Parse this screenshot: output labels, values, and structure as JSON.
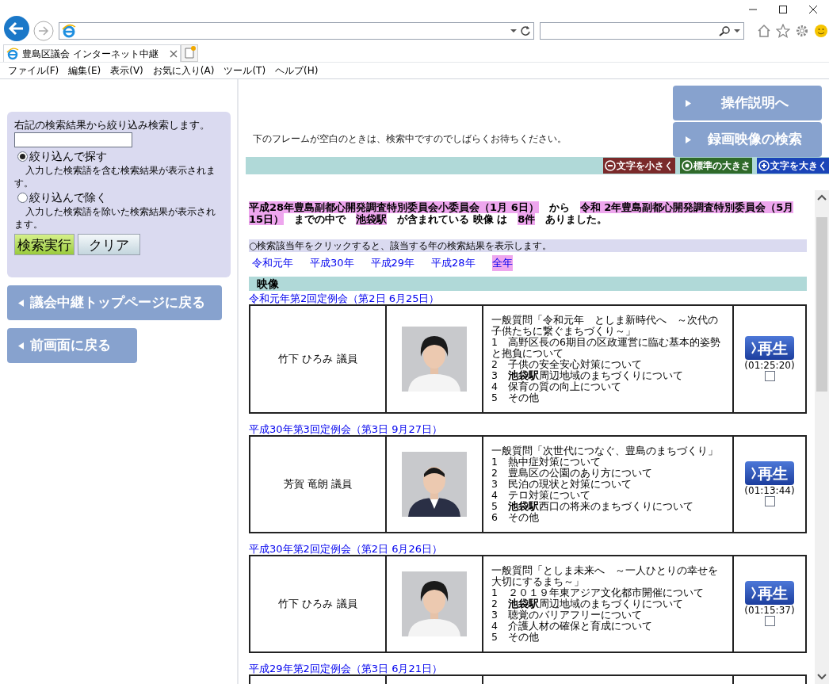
{
  "browser": {
    "tab_title": "豊島区議会 インターネット中継",
    "menu": [
      "ファイル(F)",
      "編集(E)",
      "表示(V)",
      "お気に入り(A)",
      "ツール(T)",
      "ヘルプ(H)"
    ]
  },
  "filter_panel": {
    "intro": "右記の検索結果から絞り込み検索します。",
    "options": [
      {
        "label": "絞り込んで探す",
        "selected": true,
        "note": "入力した検索語を含む検索結果が表示されます。"
      },
      {
        "label": "絞り込んで除く",
        "selected": false,
        "note": "入力した検索語を除いた検索結果が表示されます。"
      }
    ],
    "search_button": "検索実行",
    "clear_button": "クリア"
  },
  "nav_buttons": [
    "議会中継トップページに戻る",
    "前画面に戻る"
  ],
  "header": {
    "links": [
      "操作説明へ",
      "録画映像の検索"
    ],
    "notice": "下のフレームが空白のときは、検索中ですのでしばらくお待ちください。",
    "font_buttons": [
      {
        "kind": "minus",
        "label": "文字を小さく",
        "color": "#7a2a2a"
      },
      {
        "kind": "dot",
        "label": "標準の大きさ",
        "color": "#2f6a2a"
      },
      {
        "kind": "plus",
        "label": "文字を大きく",
        "color": "#1a44b8"
      }
    ]
  },
  "summary": [
    {
      "text": "平成28年豊島副都心開発調査特別委員会小委員会（1月 6日）",
      "highlight": true
    },
    {
      "text": "から",
      "highlight": false
    },
    {
      "text": "令和 2年豊島副都心開発調査特別委員会（5月15日）",
      "highlight": true
    },
    {
      "text": "までの中で",
      "highlight": false
    },
    {
      "text": "池袋駅",
      "highlight": true
    },
    {
      "text": "が含まれている 映像 は",
      "highlight": false
    },
    {
      "text": "8件",
      "highlight": true
    },
    {
      "text": "ありました。",
      "highlight": false
    }
  ],
  "year_hint": "○検索該当年をクリックすると、該当する年の検索結果を表示します。",
  "years": [
    {
      "label": "令和元年",
      "selected": false
    },
    {
      "label": "平成30年",
      "selected": false
    },
    {
      "label": "平成29年",
      "selected": false
    },
    {
      "label": "平成28年",
      "selected": false
    },
    {
      "label": "全年",
      "selected": true
    }
  ],
  "section_title": "映像",
  "results": [
    {
      "session": "令和元年第2回定例会（第2日 6月25日）",
      "member": "竹下 ひろみ 議員",
      "topics": [
        "一般質問「令和元年　としま新時代へ　～次代の子供たちに繋ぐまちづくり～」",
        "1　高野区長の6期目の区政運営に臨む基本的姿勢と抱負について",
        "2　子供の安全安心対策について",
        "3　**池袋駅**周辺地域のまちづくりについて",
        "4　保育の質の向上について",
        "5　その他"
      ],
      "play": "再生",
      "duration": "(01:25:20)",
      "checked": false
    },
    {
      "session": "平成30年第3回定例会（第3日 9月27日）",
      "member": "芳賀 竜朗 議員",
      "topics": [
        "一般質問「次世代につなぐ、豊島のまちづくり」",
        "1　熱中症対策について",
        "2　豊島区の公園のあり方について",
        "3　民泊の現状と対策について",
        "4　テロ対策について",
        "5　**池袋駅**西口の将来のまちづくりについて",
        "6　その他"
      ],
      "play": "再生",
      "duration": "(01:13:44)",
      "checked": false
    },
    {
      "session": "平成30年第2回定例会（第2日 6月26日）",
      "member": "竹下 ひろみ 議員",
      "topics": [
        "一般質問「としま未来へ　～一人ひとりの幸せを大切にするまち～」",
        "1　２０１９年東アジア文化都市開催について",
        "2　**池袋駅**周辺地域のまちづくりについて",
        "3　聴覚のバリアフリーについて",
        "4　介護人材の確保と育成について",
        "5　その他"
      ],
      "play": "再生",
      "duration": "(01:15:37)",
      "checked": false
    },
    {
      "session": "平成29年第2回定例会（第3日 6月21日）"
    }
  ]
}
